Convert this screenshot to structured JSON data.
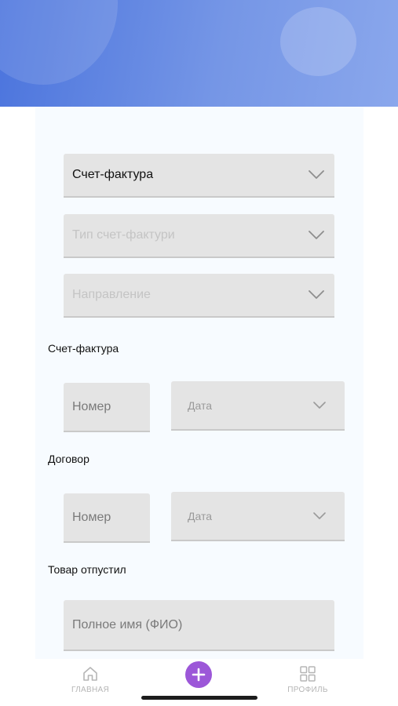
{
  "form": {
    "invoice_select": {
      "value": "Счет-фактура"
    },
    "invoice_type_select": {
      "placeholder": "Тип счет-фактури"
    },
    "direction_select": {
      "placeholder": "Направление"
    }
  },
  "sections": {
    "invoice": {
      "label": "Счет-фактура",
      "number_placeholder": "Номер",
      "date_placeholder": "Дата"
    },
    "contract": {
      "label": "Договор",
      "number_placeholder": "Номер",
      "date_placeholder": "Дата"
    },
    "goods_released": {
      "label": "Товар отпустил",
      "fullname_placeholder": "Полное имя (ФИО)"
    }
  },
  "tabbar": {
    "home_label": "ГЛАВНАЯ",
    "profile_label": "ПРОФИЛЬ"
  },
  "colors": {
    "header_gradient_start": "#4b74dd",
    "header_gradient_end": "#8aa7ec",
    "add_button": "#9c57d8",
    "field_background": "#e4e4e4"
  }
}
